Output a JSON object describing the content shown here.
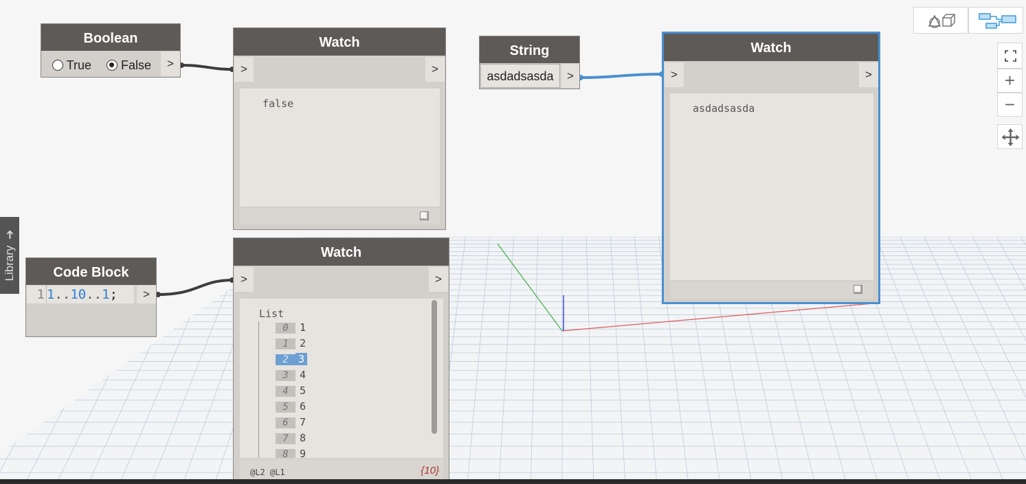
{
  "library_tab": {
    "label": "Library",
    "arrow": "➔"
  },
  "port_symbol": ">",
  "nodes": {
    "boolean": {
      "title": "Boolean",
      "options": [
        "True",
        "False"
      ],
      "selected": "False"
    },
    "watch_bool": {
      "title": "Watch",
      "value": "false"
    },
    "string": {
      "title": "String",
      "value": "asdadsasda"
    },
    "watch_string": {
      "title": "Watch",
      "value": "asdadsasda"
    },
    "code_block": {
      "title": "Code Block",
      "line_number": "1",
      "code": {
        "n1": "1",
        "op1": "..",
        "n2": "10",
        "op2": "..",
        "n3": "1",
        "end": ";"
      }
    },
    "watch_list": {
      "title": "Watch",
      "list_label": "List",
      "items": [
        {
          "index": "0",
          "value": "1"
        },
        {
          "index": "1",
          "value": "2"
        },
        {
          "index": "2",
          "value": "3"
        },
        {
          "index": "3",
          "value": "4"
        },
        {
          "index": "4",
          "value": "5"
        },
        {
          "index": "5",
          "value": "6"
        },
        {
          "index": "6",
          "value": "7"
        },
        {
          "index": "7",
          "value": "8"
        },
        {
          "index": "8",
          "value": "9"
        }
      ],
      "selected_index": "2",
      "levels": "@L2 @L1",
      "count": "{10}"
    }
  },
  "toolbar": {
    "view_buttons": [
      "geometry-view-icon",
      "graph-view-icon"
    ],
    "active_view": "graph-view-icon",
    "zoom_fit": "⛶",
    "zoom_in": "+",
    "zoom_out": "−",
    "pan": "✥"
  },
  "colors": {
    "node_header": "#5d5a58",
    "selection": "#4a8fd0",
    "wire_dark": "#3d3d3d",
    "wire_selected": "#4a8fd0",
    "list_highlight": "#6c9fd2"
  }
}
